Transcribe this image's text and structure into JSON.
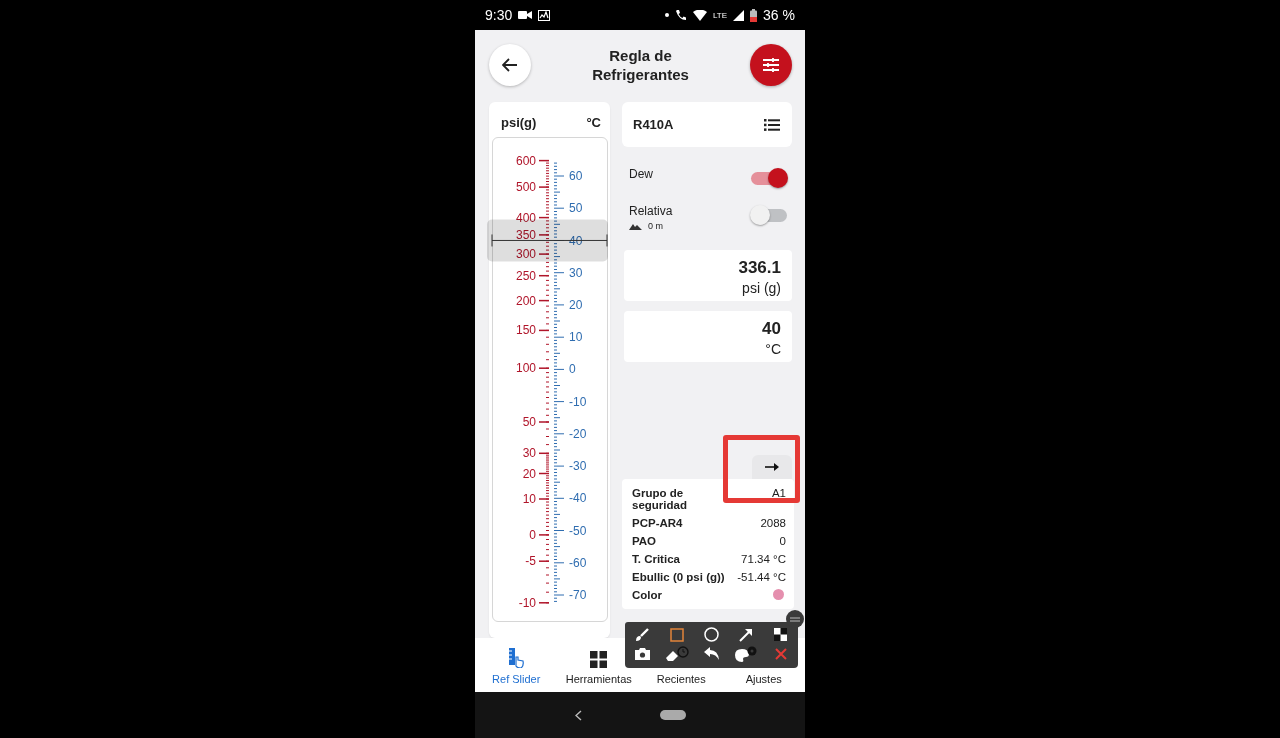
{
  "status_bar": {
    "time": "9:30",
    "network": "LTE",
    "battery": "36 %"
  },
  "header": {
    "title": "Regla de Refrigerantes"
  },
  "ruler": {
    "pressure_unit": "psi(g)",
    "temperature_unit": "°C",
    "pressure_labels": [
      "600",
      "500",
      "400",
      "350",
      "300",
      "250",
      "200",
      "150",
      "100",
      "50",
      "30",
      "20",
      "10",
      "0",
      "-5",
      "-10"
    ],
    "temperature_labels": [
      "60",
      "50",
      "40",
      "30",
      "20",
      "10",
      "0",
      "-10",
      "-20",
      "-30",
      "-40",
      "-50",
      "-60",
      "-70"
    ]
  },
  "refrigerant": {
    "name": "R410A"
  },
  "toggles": [
    {
      "label": "Dew",
      "on": true
    },
    {
      "label": "Relativa",
      "on": false,
      "note": "0 m"
    }
  ],
  "readings": [
    {
      "value": "336.1",
      "unit": "psi (g)"
    },
    {
      "value": "40",
      "unit": "°C"
    }
  ],
  "properties": [
    {
      "kind": "text",
      "label": "Grupo de seguridad",
      "value": "A1"
    },
    {
      "kind": "text",
      "label": "PCP-AR4",
      "value": "2088"
    },
    {
      "kind": "text",
      "label": "PAO",
      "value": "0"
    },
    {
      "kind": "text",
      "label": "T. Critica",
      "value": "71.34 °C"
    },
    {
      "kind": "text",
      "label": "Ebullic (0 psi (g))",
      "value": "-51.44 °C"
    },
    {
      "kind": "swatch",
      "label": "Color",
      "color": "#e58fae"
    }
  ],
  "nav": [
    {
      "label": "Ref Slider",
      "selected": true
    },
    {
      "label": "Herramientas",
      "selected": false
    },
    {
      "label": "Recientes",
      "selected": false
    },
    {
      "label": "Ajustes",
      "selected": false
    }
  ]
}
